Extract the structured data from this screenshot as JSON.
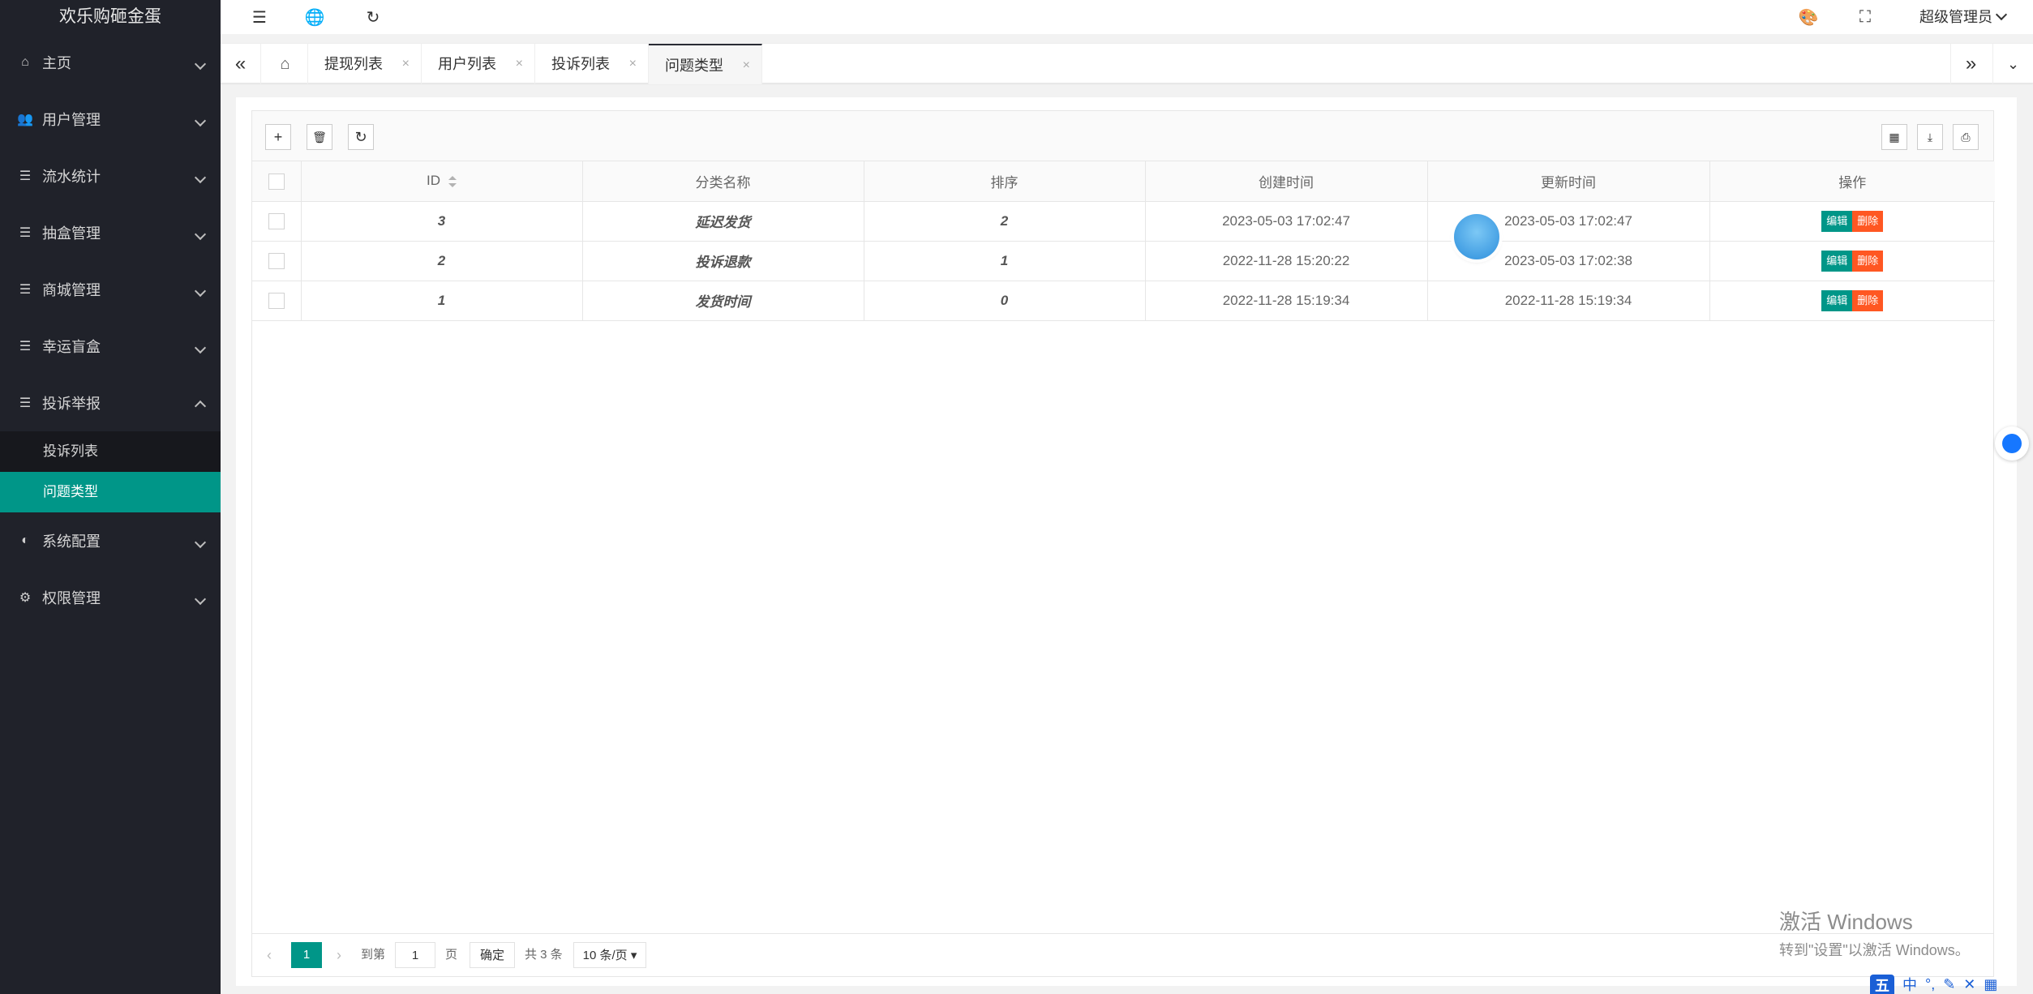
{
  "sidebar": {
    "logo": "欢乐购砸金蛋",
    "items": [
      {
        "label": "主页",
        "icon": "home-icon"
      },
      {
        "label": "用户管理",
        "icon": "users-icon"
      },
      {
        "label": "流水统计",
        "icon": "list-icon"
      },
      {
        "label": "抽盒管理",
        "icon": "list-icon"
      },
      {
        "label": "商城管理",
        "icon": "list-icon"
      },
      {
        "label": "幸运盲盒",
        "icon": "list-icon"
      },
      {
        "label": "投诉举报",
        "icon": "list-icon",
        "open": true,
        "children": [
          {
            "label": "投诉列表",
            "active": false
          },
          {
            "label": "问题类型",
            "active": true
          }
        ]
      },
      {
        "label": "系统配置",
        "icon": "config-icon"
      },
      {
        "label": "权限管理",
        "icon": "gear-icon"
      }
    ]
  },
  "header": {
    "admin_label": "超级管理员"
  },
  "tabs": [
    {
      "label": "提现列表"
    },
    {
      "label": "用户列表"
    },
    {
      "label": "投诉列表"
    },
    {
      "label": "问题类型",
      "active": true
    }
  ],
  "table": {
    "columns": [
      "ID",
      "分类名称",
      "排序",
      "创建时间",
      "更新时间",
      "操作"
    ],
    "rows": [
      {
        "id": "3",
        "name": "延迟发货",
        "sort": "2",
        "created": "2023-05-03 17:02:47",
        "updated": "2023-05-03 17:02:47"
      },
      {
        "id": "2",
        "name": "投诉退款",
        "sort": "1",
        "created": "2022-11-28 15:20:22",
        "updated": "2023-05-03 17:02:38"
      },
      {
        "id": "1",
        "name": "发货时间",
        "sort": "0",
        "created": "2022-11-28 15:19:34",
        "updated": "2022-11-28 15:19:34"
      }
    ],
    "edit_label": "编辑",
    "delete_label": "删除"
  },
  "pager": {
    "current": "1",
    "goto_label": "到第",
    "goto_value": "1",
    "page_label": "页",
    "confirm_label": "确定",
    "total_label": "共 3 条",
    "per_page": "10 条/页"
  },
  "watermark": {
    "line1": "激活 Windows",
    "line2": "转到\"设置\"以激活 Windows。"
  },
  "ime": {
    "logo": "五",
    "mode": "中"
  },
  "colors": {
    "sidebar_bg": "#20222a",
    "accent": "#009688",
    "danger": "#ff5722"
  }
}
